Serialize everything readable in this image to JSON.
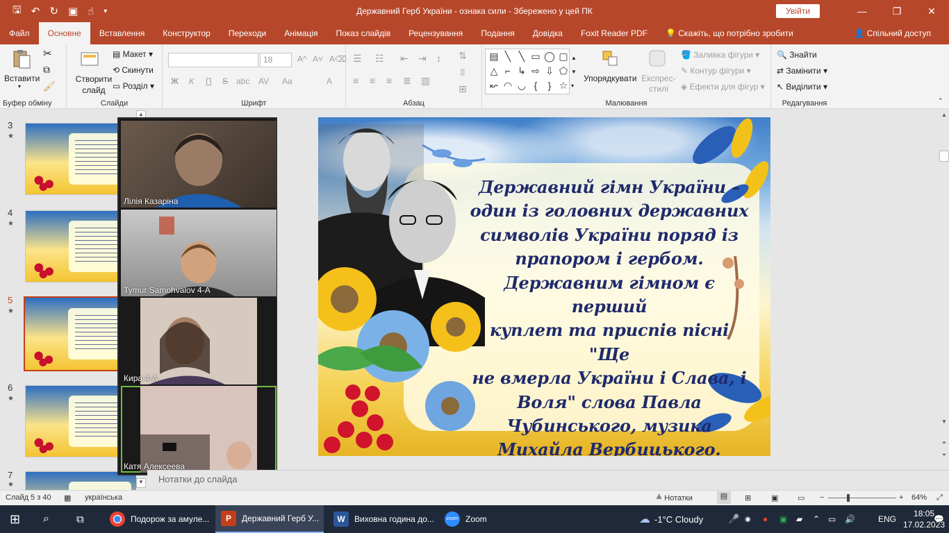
{
  "titlebar": {
    "title": "Державний Герб України - ознака сили  -  Збережено у цей ПК",
    "signin": "Увійти",
    "qat_icons": [
      "save-icon",
      "undo-icon",
      "redo-icon",
      "presentation-icon",
      "touch-mode-icon",
      "customize-icon"
    ]
  },
  "tabs": {
    "items": [
      "Файл",
      "Основне",
      "Вставлення",
      "Конструктор",
      "Переходи",
      "Анімація",
      "Показ слайдів",
      "Рецензування",
      "Подання",
      "Довідка",
      "Foxit Reader PDF"
    ],
    "tell_me": "Скажіть, що потрібно зробити",
    "share": "Спільний доступ"
  },
  "ribbon": {
    "clipboard": {
      "label": "Буфер обміну",
      "paste": "Вставити"
    },
    "slides": {
      "label": "Слайди",
      "new_slide": "Створити слайд",
      "layout": "Макет",
      "reset": "Скинути",
      "section": "Розділ"
    },
    "font": {
      "label": "Шрифт",
      "font_name": "",
      "font_size": "18",
      "bold": "Ж",
      "italic": "К",
      "underline": "П",
      "strike": "S",
      "shadow": "abc",
      "spacing": "AV",
      "case": "Aa",
      "color": "A"
    },
    "paragraph": {
      "label": "Абзац"
    },
    "drawing": {
      "label": "Малювання",
      "arrange": "Упорядкувати",
      "quick_styles": "Експрес-стилі",
      "fill": "Заливка фігури",
      "outline": "Контур фігури",
      "effects": "Ефекти для фігур"
    },
    "editing": {
      "label": "Редагування",
      "find": "Знайти",
      "replace": "Замінити",
      "select": "Виділити"
    }
  },
  "thumbnails": [
    {
      "num": "3",
      "active": false
    },
    {
      "num": "4",
      "active": false
    },
    {
      "num": "5",
      "active": true
    },
    {
      "num": "6",
      "active": false
    },
    {
      "num": "7",
      "active": false
    }
  ],
  "zoom_participants": [
    {
      "name": "Лілія Казаріна",
      "active": false
    },
    {
      "name": "Tymur Samohvalov 4-A",
      "active": false
    },
    {
      "name": "Кира 4-А",
      "active": false
    },
    {
      "name": "Катя Алексеева",
      "active": true
    }
  ],
  "slide": {
    "text_lines": [
      "Державний гімн України –",
      "один із головних державних",
      "символів України поряд із",
      "прапором і гербом.",
      "Державним гімном є перший",
      "куплет та приспів пісні \"Ще",
      "не вмерла України і Слава, і",
      "Воля\"  слова  Павла",
      "Чубинського, музика",
      "Михайла Вербицького."
    ]
  },
  "notes": {
    "placeholder": "Нотатки до слайда"
  },
  "status": {
    "slide_of": "Слайд 5 з 40",
    "language": "українська",
    "notes_btn": "Нотатки",
    "zoom": "64%",
    "zoom_fraction": 0.64
  },
  "taskbar": {
    "apps": [
      {
        "label": "Подорож за амуле...",
        "icon": "chrome-icon",
        "color": "#ea4335"
      },
      {
        "label": "Державний Герб У...",
        "icon": "powerpoint-icon",
        "color": "#c43e1c"
      },
      {
        "label": "Виховна година до...",
        "icon": "word-icon",
        "color": "#2b579a"
      },
      {
        "label": "Zoom",
        "icon": "zoom-icon",
        "color": "#2d8cff"
      }
    ],
    "weather": "-1°C  Cloudy",
    "lang": "ENG",
    "time": "18:05",
    "date": "17.02.2023"
  },
  "colors": {
    "accent": "#b7472a",
    "slide_text": "#1f2a6b",
    "active_thumb": "#c43e1c"
  }
}
